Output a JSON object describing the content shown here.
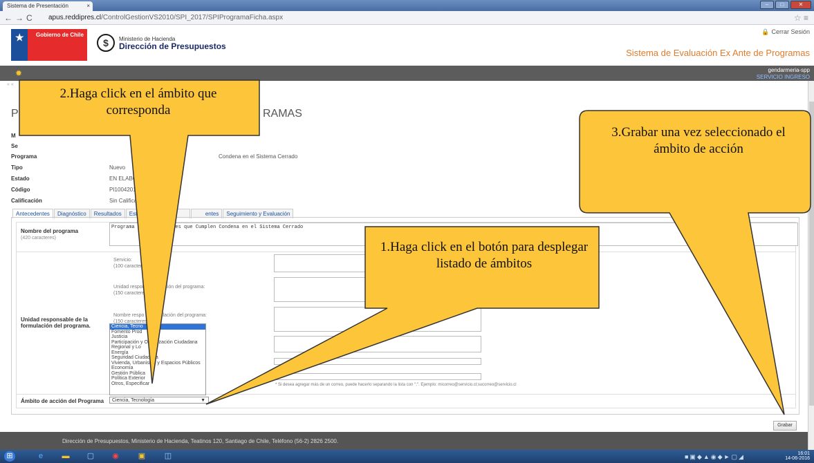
{
  "browser": {
    "tab_title": "Sistema de Presentación",
    "tab_close": "×",
    "url_host": "apus.reddipres.cl",
    "url_path": "/ControlGestionVS2010/SPI_2017/SPIProgramaFicha.aspx"
  },
  "header": {
    "gobierno": "Gobierno de Chile",
    "ministerio": "Ministerio de Hacienda",
    "direccion": "Dirección de Presupuestos",
    "cerrar_sesion": "Cerrar Sesión",
    "system_title": "Sistema de Evaluación Ex Ante de Programas",
    "user": "gendarmeria-spp",
    "user_role": "SERVICIO INGRESO"
  },
  "page": {
    "title_start": "P",
    "title_end": "RAMAS",
    "fields": [
      {
        "label": "M",
        "value": ""
      },
      {
        "label": "Se",
        "value": ""
      },
      {
        "label": "Programa",
        "value": "Condena en el Sistema Cerrado"
      },
      {
        "label": "Tipo",
        "value": "Nuevo"
      },
      {
        "label": "Estado",
        "value": "EN ELABORACIÓN IN"
      },
      {
        "label": "Código",
        "value": "PI100420170007986"
      },
      {
        "label": "Calificación",
        "value": "Sin Calificación y/o V"
      }
    ]
  },
  "tabs": [
    "Antecedentes",
    "Diagnóstico",
    "Resultados",
    "Estrategia",
    "",
    "entes",
    "Seguimiento y Evaluación"
  ],
  "form": {
    "nombre_label": "Nombre del programa",
    "nombre_sub": "(420 caracteres)",
    "nombre_value": "Programa de Rein                    Jóvenes que Cumplen Condena en el Sistema Cerrado",
    "servicio_label": "Servicio:",
    "servicio_sub": "(100 caracteres)",
    "unidad_small_label": "Unidad respons          formulación del programa:",
    "unidad_small_sub": "(150 caracteres)",
    "unidad_label": "Unidad responsable de la formulación del programa.",
    "nombre_resp_label": "Nombre respo          la formulación del programa:",
    "nombre_resp_sub": "(150 caracteres)",
    "hint": "* Si desea agregar más de un correo, puede hacerlo separando la lista con \";\". Ejemplo: micorreo@servicio.cl;sucorreo@servicio.cl",
    "ambito_label": "Ámbito de acción del Programa",
    "ambito_selected": "Ciencia, Tecnología",
    "ambito_options": [
      "Ciencia, Tecno",
      "Fomento Prod",
      "Justicia",
      "Participación y Organización Ciudadana",
      "Regional y Lo",
      "Energía",
      "Seguridad Ciudadana",
      "Vivienda, Urbanismo y Espacios Públicos",
      "Economía",
      "Gestión Pública",
      "Política Exterior",
      "Otros, Especificar"
    ],
    "grabar": "Grabar"
  },
  "footer": "Dirección de Presupuestos, Ministerio de Hacienda, Teatinos 120, Santiago de Chile, Teléfono (56-2) 2826 2500.",
  "callouts": {
    "c1": "1.Haga click en el botón para desplegar listado de ámbitos",
    "c2": "2.Haga click en el ámbito que corresponda",
    "c3": "3.Grabar una vez seleccionado el ámbito de acción"
  },
  "taskbar": {
    "time": "16:01",
    "date": "14-06-2016"
  }
}
